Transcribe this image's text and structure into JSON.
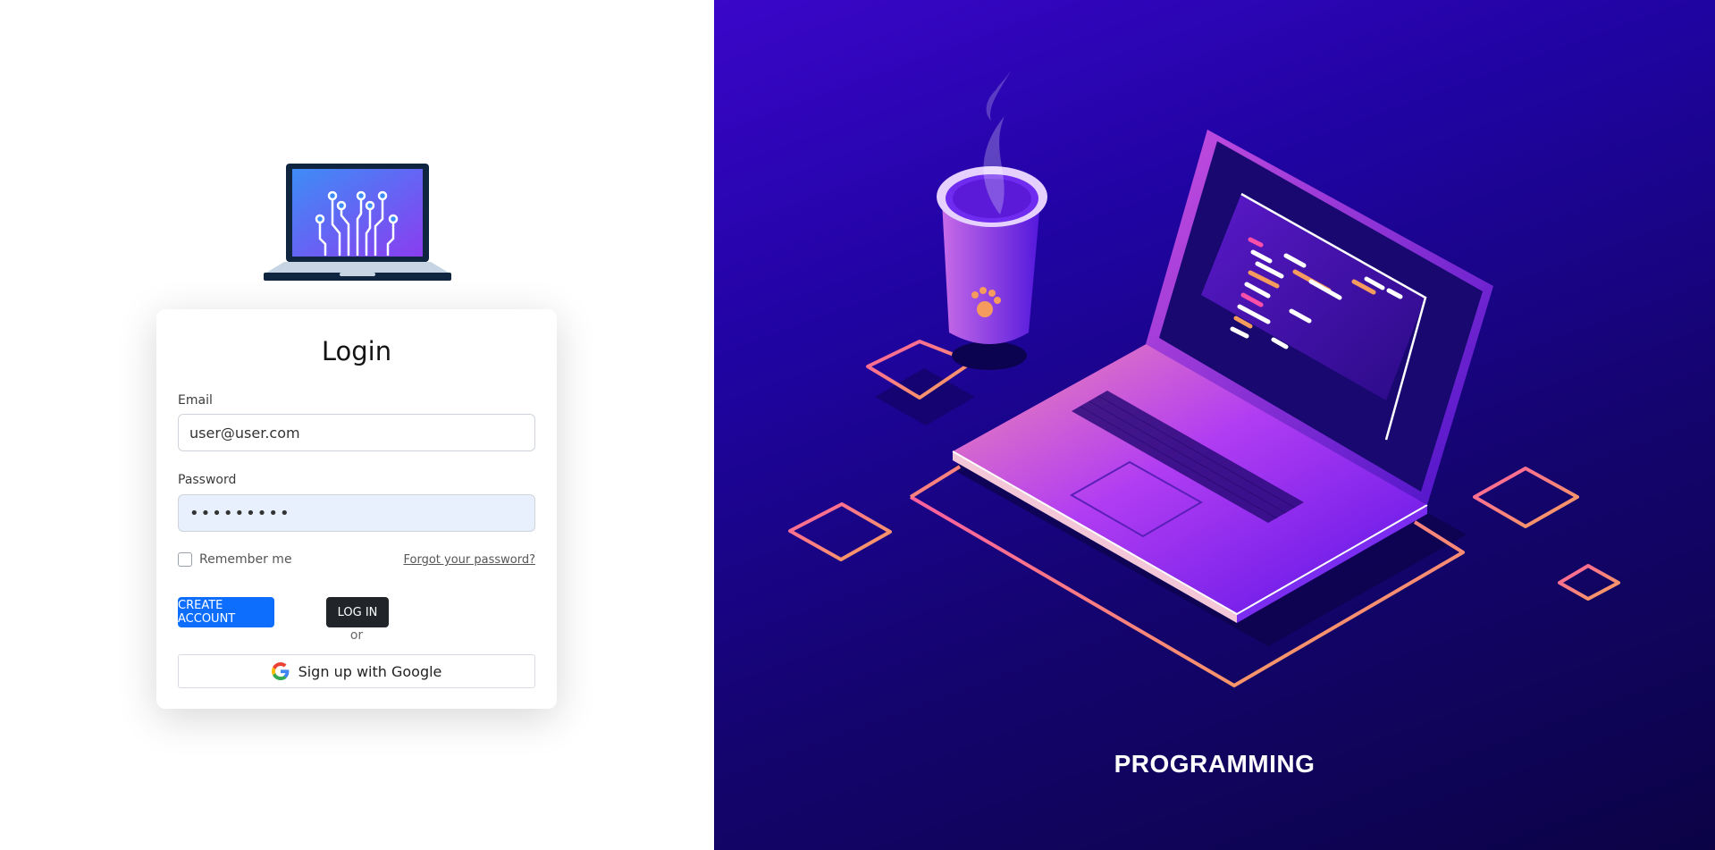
{
  "login": {
    "title": "Login",
    "email_label": "Email",
    "email_value": "user@user.com",
    "password_label": "Password",
    "password_value": "•••••••••",
    "remember_label": "Remember me",
    "forgot_link": "Forgot your password?",
    "create_account_button": "CREATE ACCOUNT",
    "login_button": "LOG IN",
    "or_text": "or",
    "google_button": "Sign up with Google"
  },
  "hero": {
    "caption": "PROGRAMMING"
  },
  "icons": {
    "logo": "laptop-circuit-icon",
    "google": "google-icon"
  },
  "colors": {
    "primary": "#0d6efd",
    "dark": "#212529",
    "hero_top": "#3a06c9",
    "hero_bottom": "#0b0346",
    "accent_pink": "#ff6d9a",
    "accent_orange": "#f59b5d"
  }
}
